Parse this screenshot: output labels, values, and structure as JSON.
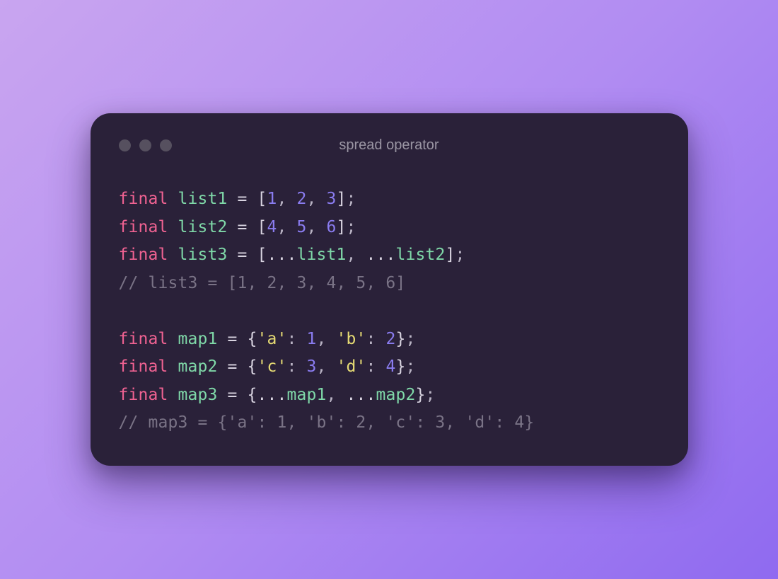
{
  "window": {
    "title": "spread operator"
  },
  "code": {
    "lines": [
      [
        {
          "cls": "kw",
          "t": "final"
        },
        {
          "cls": "op",
          "t": " "
        },
        {
          "cls": "id",
          "t": "list1"
        },
        {
          "cls": "op",
          "t": " "
        },
        {
          "cls": "op",
          "t": "="
        },
        {
          "cls": "op",
          "t": " "
        },
        {
          "cls": "br",
          "t": "["
        },
        {
          "cls": "num",
          "t": "1"
        },
        {
          "cls": "pn",
          "t": ","
        },
        {
          "cls": "op",
          "t": " "
        },
        {
          "cls": "num",
          "t": "2"
        },
        {
          "cls": "pn",
          "t": ","
        },
        {
          "cls": "op",
          "t": " "
        },
        {
          "cls": "num",
          "t": "3"
        },
        {
          "cls": "br",
          "t": "]"
        },
        {
          "cls": "pn",
          "t": ";"
        }
      ],
      [
        {
          "cls": "kw",
          "t": "final"
        },
        {
          "cls": "op",
          "t": " "
        },
        {
          "cls": "id",
          "t": "list2"
        },
        {
          "cls": "op",
          "t": " "
        },
        {
          "cls": "op",
          "t": "="
        },
        {
          "cls": "op",
          "t": " "
        },
        {
          "cls": "br",
          "t": "["
        },
        {
          "cls": "num",
          "t": "4"
        },
        {
          "cls": "pn",
          "t": ","
        },
        {
          "cls": "op",
          "t": " "
        },
        {
          "cls": "num",
          "t": "5"
        },
        {
          "cls": "pn",
          "t": ","
        },
        {
          "cls": "op",
          "t": " "
        },
        {
          "cls": "num",
          "t": "6"
        },
        {
          "cls": "br",
          "t": "]"
        },
        {
          "cls": "pn",
          "t": ";"
        }
      ],
      [
        {
          "cls": "kw",
          "t": "final"
        },
        {
          "cls": "op",
          "t": " "
        },
        {
          "cls": "id",
          "t": "list3"
        },
        {
          "cls": "op",
          "t": " "
        },
        {
          "cls": "op",
          "t": "="
        },
        {
          "cls": "op",
          "t": " "
        },
        {
          "cls": "br",
          "t": "["
        },
        {
          "cls": "op",
          "t": "..."
        },
        {
          "cls": "id",
          "t": "list1"
        },
        {
          "cls": "pn",
          "t": ","
        },
        {
          "cls": "op",
          "t": " "
        },
        {
          "cls": "op",
          "t": "..."
        },
        {
          "cls": "id",
          "t": "list2"
        },
        {
          "cls": "br",
          "t": "]"
        },
        {
          "cls": "pn",
          "t": ";"
        }
      ],
      [
        {
          "cls": "cm",
          "t": "// list3 = [1, 2, 3, 4, 5, 6]"
        }
      ],
      [
        {
          "cls": "op",
          "t": ""
        }
      ],
      [
        {
          "cls": "kw",
          "t": "final"
        },
        {
          "cls": "op",
          "t": " "
        },
        {
          "cls": "id",
          "t": "map1"
        },
        {
          "cls": "op",
          "t": " "
        },
        {
          "cls": "op",
          "t": "="
        },
        {
          "cls": "op",
          "t": " "
        },
        {
          "cls": "br",
          "t": "{"
        },
        {
          "cls": "str",
          "t": "'a'"
        },
        {
          "cls": "pn",
          "t": ":"
        },
        {
          "cls": "op",
          "t": " "
        },
        {
          "cls": "num",
          "t": "1"
        },
        {
          "cls": "pn",
          "t": ","
        },
        {
          "cls": "op",
          "t": " "
        },
        {
          "cls": "str",
          "t": "'b'"
        },
        {
          "cls": "pn",
          "t": ":"
        },
        {
          "cls": "op",
          "t": " "
        },
        {
          "cls": "num",
          "t": "2"
        },
        {
          "cls": "br",
          "t": "}"
        },
        {
          "cls": "pn",
          "t": ";"
        }
      ],
      [
        {
          "cls": "kw",
          "t": "final"
        },
        {
          "cls": "op",
          "t": " "
        },
        {
          "cls": "id",
          "t": "map2"
        },
        {
          "cls": "op",
          "t": " "
        },
        {
          "cls": "op",
          "t": "="
        },
        {
          "cls": "op",
          "t": " "
        },
        {
          "cls": "br",
          "t": "{"
        },
        {
          "cls": "str",
          "t": "'c'"
        },
        {
          "cls": "pn",
          "t": ":"
        },
        {
          "cls": "op",
          "t": " "
        },
        {
          "cls": "num",
          "t": "3"
        },
        {
          "cls": "pn",
          "t": ","
        },
        {
          "cls": "op",
          "t": " "
        },
        {
          "cls": "str",
          "t": "'d'"
        },
        {
          "cls": "pn",
          "t": ":"
        },
        {
          "cls": "op",
          "t": " "
        },
        {
          "cls": "num",
          "t": "4"
        },
        {
          "cls": "br",
          "t": "}"
        },
        {
          "cls": "pn",
          "t": ";"
        }
      ],
      [
        {
          "cls": "kw",
          "t": "final"
        },
        {
          "cls": "op",
          "t": " "
        },
        {
          "cls": "id",
          "t": "map3"
        },
        {
          "cls": "op",
          "t": " "
        },
        {
          "cls": "op",
          "t": "="
        },
        {
          "cls": "op",
          "t": " "
        },
        {
          "cls": "br",
          "t": "{"
        },
        {
          "cls": "op",
          "t": "..."
        },
        {
          "cls": "id",
          "t": "map1"
        },
        {
          "cls": "pn",
          "t": ","
        },
        {
          "cls": "op",
          "t": " "
        },
        {
          "cls": "op",
          "t": "..."
        },
        {
          "cls": "id",
          "t": "map2"
        },
        {
          "cls": "br",
          "t": "}"
        },
        {
          "cls": "pn",
          "t": ";"
        }
      ],
      [
        {
          "cls": "cm",
          "t": "// map3 = {'a': 1, 'b': 2, 'c': 3, 'd': 4}"
        }
      ]
    ]
  }
}
